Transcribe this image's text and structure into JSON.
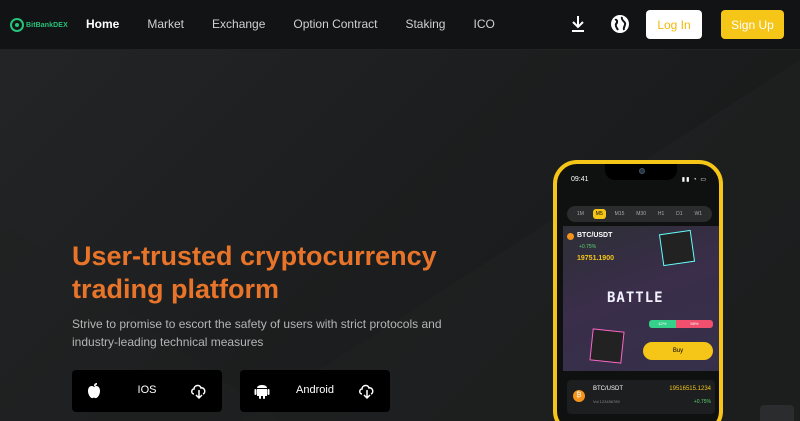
{
  "header": {
    "logo_text": "BitBankDEX",
    "nav": [
      "Home",
      "Market",
      "Exchange",
      "Option Contract",
      "Staking",
      "ICO"
    ],
    "active_nav": "Home",
    "login_label": "Log In",
    "signup_label": "Sign Up",
    "icons": [
      "download-icon",
      "globe-icon"
    ]
  },
  "hero": {
    "title": "User-trusted cryptocurrency trading platform",
    "subtitle": "Strive to promise to escort the safety of users with strict protocols and industry-leading technical measures"
  },
  "apps": [
    {
      "label": "IOS",
      "icon": "apple-icon"
    },
    {
      "label": "Android",
      "icon": "android-icon"
    }
  ],
  "phone": {
    "time": "09:41",
    "tabs": [
      "1M",
      "M5",
      "M15",
      "M30",
      "H1",
      "D1",
      "W1"
    ],
    "active_tab": "M5",
    "pair": "BTC/USDT",
    "change": "+0.75%",
    "price": "19751.1900",
    "battle_label": "BATTLE",
    "bar_left": "42%",
    "bar_right": "58%",
    "buy_label": "Buy",
    "row": {
      "pair": "BTC/USDT",
      "vol": "Vol 123456789",
      "price": "19516515.1234",
      "change": "+0.75%"
    }
  },
  "colors": {
    "accent_yellow": "#f5c518",
    "title_orange": "#e8742a",
    "logo_green": "#27c27a"
  }
}
